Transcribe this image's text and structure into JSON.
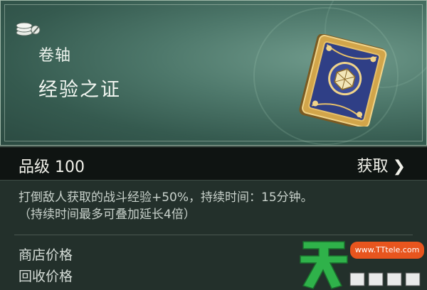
{
  "item": {
    "category": "卷轴",
    "name": "经验之证",
    "type_icon": "coin-stack-icon",
    "art_icon": "ornate-card-icon"
  },
  "grade": {
    "label": "品级 100",
    "obtain_label": "获取",
    "obtain_icon": "chevron-right-icon"
  },
  "description": {
    "line1": "打倒敌人获取的战斗经验+50%，持续时间：15分钟。",
    "line2": "（持续时间最多可叠加延长4倍）"
  },
  "prices": {
    "shop_label": "商店价格",
    "recycle_label": "回收价格"
  },
  "watermark": {
    "url": "www.TTtele.com"
  },
  "colors": {
    "header_teal": "#4d776a",
    "grade_bar": "#0f1412",
    "watermark_green": "#2fb24a",
    "watermark_orange": "#e8551e"
  }
}
